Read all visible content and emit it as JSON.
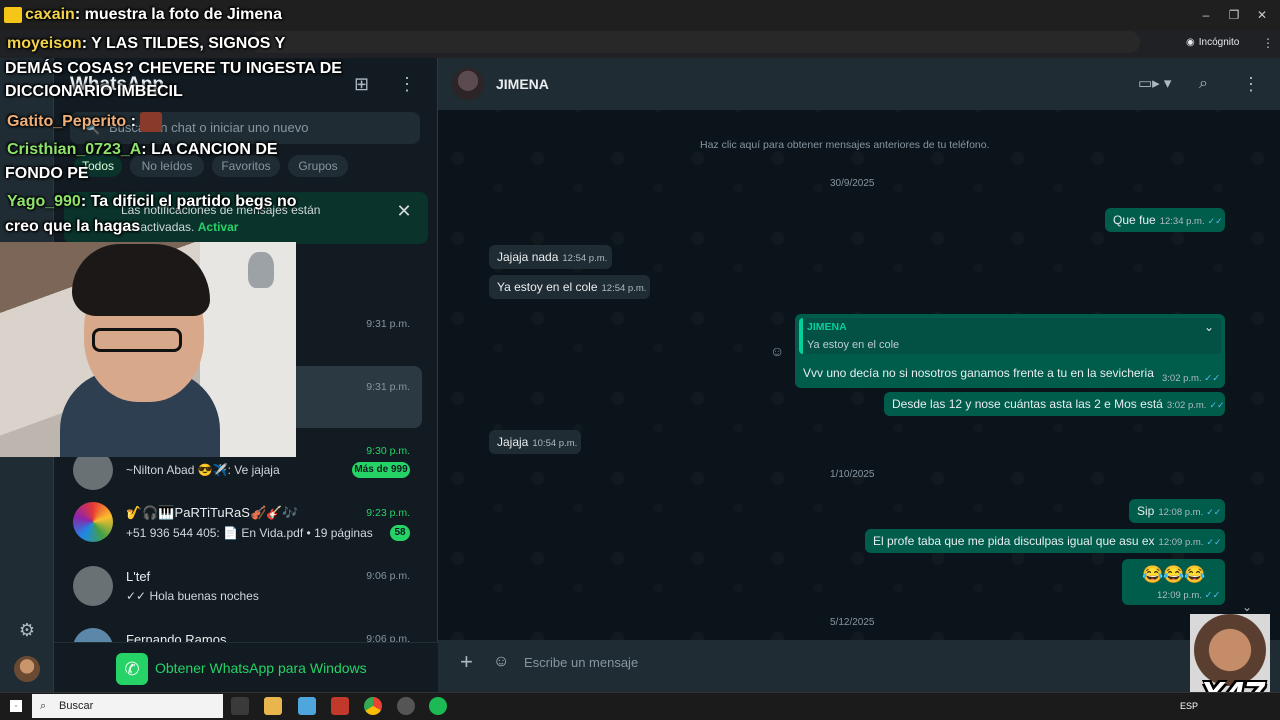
{
  "browser": {
    "incognito_label": "Incógnito"
  },
  "stream_chat": [
    {
      "user": "caxain",
      "text": ": muestra la foto de Jimena"
    },
    {
      "user": "moyeison",
      "text": ": Y LAS TILDES, SIGNOS Y"
    },
    {
      "text": "DEMÁS COSAS? CHEVERE TU INGESTA DE"
    },
    {
      "text": "DICCIONARIO IMBECIL"
    },
    {
      "user": "Gatito_Peperito",
      "text": ":"
    },
    {
      "user": "Cristhian_0723_A",
      "text": ": LA CANCION DE"
    },
    {
      "text": "FONDO PE"
    },
    {
      "user": "Yago_990",
      "text": ": Ta dificil el partido begs no"
    },
    {
      "text": "creo que la hagas"
    }
  ],
  "sidebar": {
    "title": "WhatsApp",
    "search_placeholder": "Buscar un chat o iniciar uno nuevo",
    "filters": [
      "Todos",
      "No leídos",
      "Favoritos",
      "Grupos"
    ],
    "notification": {
      "text": "Las notificaciones de mensajes están desactivadas.",
      "action": "Activar"
    },
    "chats": [
      {
        "time": "9:31 p.m."
      },
      {
        "time": "9:31 p.m."
      },
      {
        "time": "9:30 p.m.",
        "name": "",
        "preview": "~Nilton Abad 😎✈️: Ve jajaja",
        "badge": "Más de 999"
      },
      {
        "time": "9:23 p.m.",
        "name": "🎷🎧🎹PaRTiTuRaS🎻🎸🎶",
        "preview": "+51 936 544 405: 📄 En Vida.pdf • 19 páginas",
        "badge": "58"
      },
      {
        "time": "9:06 p.m.",
        "name": "L'tef",
        "preview": "✓✓ Hola buenas noches"
      },
      {
        "time": "9:06 p.m.",
        "name": "Fernando Ramos"
      }
    ],
    "get_app": "Obtener WhatsApp para Windows"
  },
  "conversation": {
    "contact": "JIMENA",
    "older_notice": "Haz clic aquí para obtener mensajes anteriores de tu teléfono.",
    "dates": [
      "30/9/2025",
      "1/10/2025",
      "5/12/2025"
    ],
    "messages": [
      {
        "dir": "out",
        "text": "Que fue",
        "time": "12:34 p.m."
      },
      {
        "dir": "in",
        "text": "Jajaja nada",
        "time": "12:54 p.m."
      },
      {
        "dir": "in",
        "text": "Ya estoy en el cole",
        "time": "12:54 p.m."
      },
      {
        "dir": "out",
        "quote_author": "JIMENA",
        "quote_text": "Ya estoy en el cole",
        "text": "Vvv  uno decía no si nosotros ganamos frente a tu   en la sevicheria",
        "time": "3:02 p.m."
      },
      {
        "dir": "out",
        "text": "Desde las 12 y nose cuántas asta las 2 e Mos está",
        "time": "3:02 p.m."
      },
      {
        "dir": "in",
        "text": "Jajaja",
        "time": "10:54 p.m."
      },
      {
        "dir": "out",
        "text": "Sip",
        "time": "12:08 p.m."
      },
      {
        "dir": "out",
        "text": "El profe taba que  me pida disculpas igual que asu ex",
        "time": "12:09 p.m."
      },
      {
        "dir": "out",
        "text": "😂😂😂",
        "time": "12:09 p.m."
      }
    ],
    "composer_placeholder": "Escribe un mensaje"
  },
  "taskbar": {
    "search_label": "Buscar",
    "lang": "ESP"
  },
  "overlay": {
    "emote_label": "X47"
  },
  "colors": {
    "accent_green": "#25d366",
    "outgoing_bubble": "#005c4b",
    "incoming_bubble": "#202c33",
    "read_ticks": "#53bdeb"
  }
}
